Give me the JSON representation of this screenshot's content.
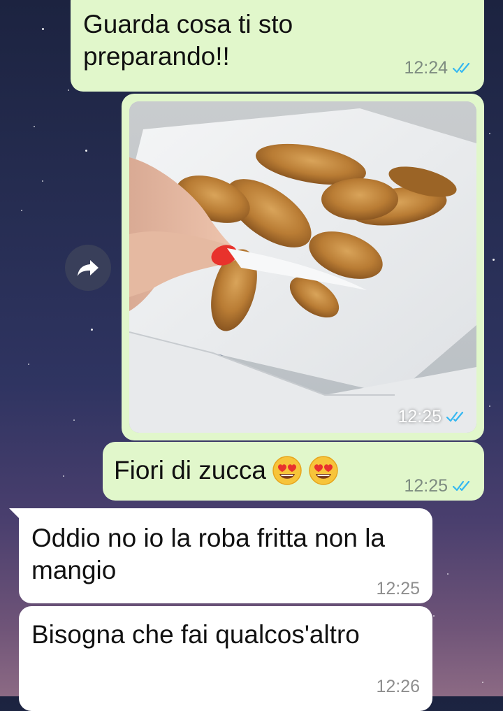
{
  "conversation": {
    "messages": [
      {
        "direction": "outgoing",
        "type": "text",
        "text": "Guarda cosa ti sto preparando!!",
        "time": "12:24",
        "status": "read"
      },
      {
        "direction": "outgoing",
        "type": "image",
        "time": "12:25",
        "status": "read",
        "image_description_icon": "photo-fried-zucchini-flowers"
      },
      {
        "direction": "outgoing",
        "type": "text",
        "text": "Fiori di zucca",
        "emoji": [
          "😍",
          "😍"
        ],
        "time": "12:25",
        "status": "read"
      },
      {
        "direction": "incoming",
        "type": "text",
        "text": "Oddio no io la roba fritta non la mangio",
        "time": "12:25"
      },
      {
        "direction": "incoming",
        "type": "text",
        "text": "Bisogna che fai qualcos'altro",
        "time": "12:26"
      }
    ]
  },
  "colors": {
    "outgoing_bubble": "#e1f7cb",
    "incoming_bubble": "#ffffff",
    "read_ticks": "#34b7f1",
    "background_top": "#1c2340",
    "background_bottom": "#8c6a84"
  },
  "icons": {
    "forward": "share-forward-icon",
    "read_receipt": "double-check-icon"
  }
}
